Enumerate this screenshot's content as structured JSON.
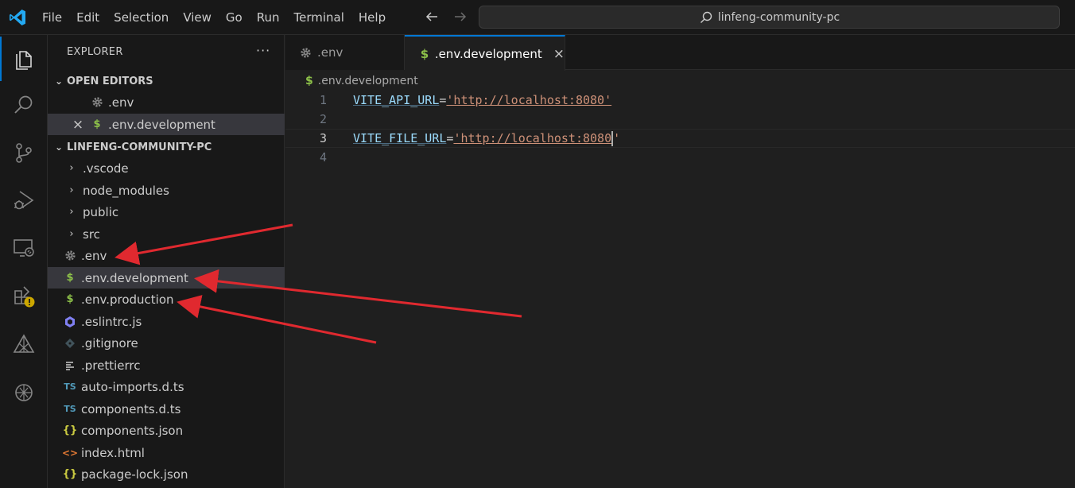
{
  "menu": [
    "File",
    "Edit",
    "Selection",
    "View",
    "Go",
    "Run",
    "Terminal",
    "Help"
  ],
  "command_center": {
    "text": "linfeng-community-pc"
  },
  "activity": [
    "explorer-icon",
    "search-icon",
    "source-control-icon",
    "run-debug-icon",
    "remote-explorer-icon",
    "extensions-icon",
    "warning-badge-icon",
    "triangle-extension-icon",
    "openai-extension-icon"
  ],
  "sidebar": {
    "header": "EXPLORER",
    "more": "···",
    "open_editors": {
      "title": "OPEN EDITORS",
      "items": [
        {
          "label": ".env",
          "icon": "gear-icon"
        },
        {
          "label": ".env.development",
          "icon": "dollar-icon",
          "close": "×"
        }
      ]
    },
    "project": {
      "title": "LINFENG-COMMUNITY-PC",
      "items": [
        {
          "label": ".vscode",
          "icon": "chevron-right-icon"
        },
        {
          "label": "node_modules",
          "icon": "chevron-right-icon"
        },
        {
          "label": "public",
          "icon": "chevron-right-icon"
        },
        {
          "label": "src",
          "icon": "chevron-right-icon"
        },
        {
          "label": ".env",
          "icon": "gear-icon"
        },
        {
          "label": ".env.development",
          "icon": "dollar-icon"
        },
        {
          "label": ".env.production",
          "icon": "dollar-icon"
        },
        {
          "label": ".eslintrc.js",
          "icon": "eslint-icon"
        },
        {
          "label": ".gitignore",
          "icon": "git-icon"
        },
        {
          "label": ".prettierrc",
          "icon": "lines-icon"
        },
        {
          "label": "auto-imports.d.ts",
          "icon": "ts-icon",
          "glyph": "TS"
        },
        {
          "label": "components.d.ts",
          "icon": "ts-icon",
          "glyph": "TS"
        },
        {
          "label": "components.json",
          "icon": "json-icon",
          "glyph": "{}"
        },
        {
          "label": "index.html",
          "icon": "html-icon",
          "glyph": "<>"
        },
        {
          "label": "package-lock.json",
          "icon": "json-icon",
          "glyph": "{}"
        }
      ]
    }
  },
  "tabs": [
    {
      "label": ".env",
      "icon": "gear-icon",
      "active": false
    },
    {
      "label": ".env.development",
      "icon": "dollar-icon",
      "active": true,
      "close": "×"
    }
  ],
  "breadcrumb": {
    "icon": "$",
    "label": ".env.development"
  },
  "editor": {
    "lines": [
      {
        "number": "1",
        "key": "VITE_API_URL",
        "eq": "=",
        "value": "'http://localhost:8080'"
      },
      {
        "number": "2",
        "key": "",
        "eq": "",
        "value": ""
      },
      {
        "number": "3",
        "key": "VITE_FILE_URL",
        "eq": "=",
        "value": "'http://localhost:8080'"
      },
      {
        "number": "4",
        "key": "",
        "eq": "",
        "value": ""
      }
    ],
    "current_line": 3
  },
  "colors": {
    "accent": "#0078d4",
    "annotation_arrow": "#e0292f",
    "dollar": "#8dc149",
    "ts": "#519aba",
    "json": "#cbcb41",
    "html": "#e37933"
  }
}
